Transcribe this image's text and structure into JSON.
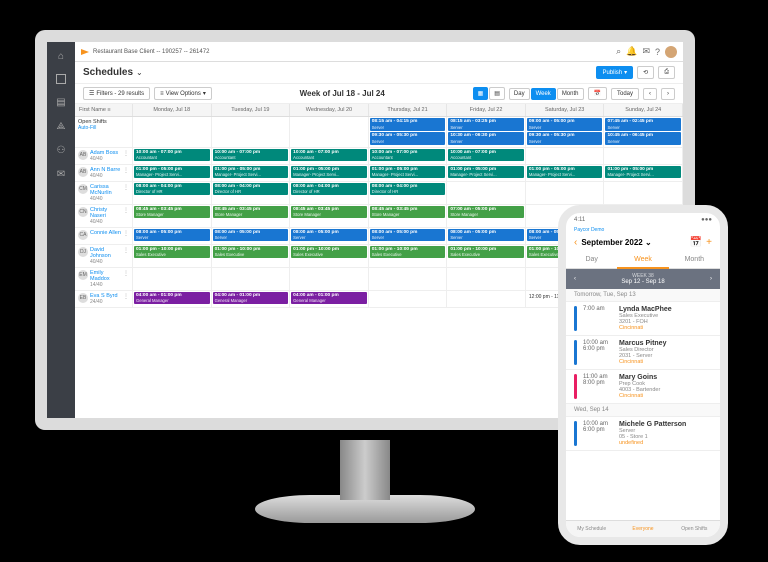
{
  "breadcrumb": "Restaurant Base Client -- 190257 -- 261472",
  "page_title": "Schedules",
  "publish": "Publish",
  "filters": "Filters - 29 results",
  "viewopts": "View Options",
  "week_label": "Week of Jul 18 - Jul 24",
  "views": {
    "day": "Day",
    "week": "Week",
    "month": "Month",
    "today": "Today"
  },
  "cols": [
    "First Name",
    "Monday, Jul 18",
    "Tuesday, Jul 19",
    "Wednesday, Jul 20",
    "Thursday, Jul 21",
    "Friday, Jul 22",
    "Saturday, Jul 23",
    "Sunday, Jul 24"
  ],
  "open": {
    "label": "Open Shifts",
    "auto": "Auto-Fill",
    "shifts": [
      {
        "t": "08:15 am - 04:15 pm",
        "r": "Server"
      },
      {
        "t": "08:15 am - 03:25 pm",
        "r": "Server"
      },
      {
        "t": "09:00 am - 05:00 pm",
        "r": "Server"
      },
      {
        "t": "07:45 am - 02:45 pm",
        "r": "Server"
      },
      {
        "t": "09:30 am - 05:30 pm",
        "r": "Server"
      },
      {
        "t": "10:30 am - 06:30 pm",
        "r": "Server"
      },
      {
        "t": "09:30 am - 05:30 pm",
        "r": "Server"
      },
      {
        "t": "10:45 am - 06:45 pm",
        "r": "Server"
      }
    ]
  },
  "rows": [
    {
      "i": "AB",
      "n": "Adam Boss",
      "h": "40/40",
      "c": "s-teal",
      "s": "10:00 am - 07:00 pm",
      "r": "Accountant",
      "days": 5
    },
    {
      "i": "AB",
      "n": "Ann N Barre",
      "h": "40/40",
      "c": "s-teal",
      "s": "01:00 pm - 05:00 pm",
      "r": "Manager- Project Servi...",
      "days": 7
    },
    {
      "i": "CM",
      "n": "Carissa McNurlin",
      "h": "40/40",
      "c": "s-teal",
      "s": "08:00 am - 04:00 pm",
      "r": "Director of HR",
      "days": 4
    },
    {
      "i": "CN",
      "n": "Christy Naseri",
      "h": "40/40",
      "c": "s-green",
      "s": "08:45 am - 03:45 pm",
      "r": "Store Manager",
      "days": 4,
      "extra": {
        "t": "07:00 am - 05:00 pm",
        "r": "Store Manager"
      }
    },
    {
      "i": "CA",
      "n": "Connie Allen",
      "h": "",
      "c": "s-blue",
      "s": "08:00 am - 05:00 pm",
      "r": "Server",
      "days": 6
    },
    {
      "i": "DJ",
      "n": "David Johnson",
      "h": "40/40",
      "c": "s-green",
      "s": "01:00 pm - 10:00 pm",
      "r": "Sales Executive",
      "days": 6
    },
    {
      "i": "EM",
      "n": "Emily Maddox",
      "h": "14/40",
      "c": "",
      "s": "",
      "r": "",
      "days": 0
    },
    {
      "i": "EB",
      "n": "Eva S Byrd",
      "h": "24/40",
      "c": "s-purple",
      "s": "04:00 am - 01:00 pm",
      "r": "General Manager",
      "days": 3,
      "tail": "12:00 pm - 11:59 pm"
    }
  ],
  "phone": {
    "time": "4:11",
    "carrier": "Paycor Demo",
    "month": "September 2022",
    "tabs": {
      "day": "Day",
      "week": "Week",
      "month": "Month"
    },
    "wk_label": "WEEK 38",
    "wk_range": "Sep 12 - Sep 18",
    "sec1": "Tomorrow, Tue, Sep 13",
    "items": [
      {
        "c": "#1976d2",
        "t1": "7:00 am",
        "t2": "",
        "n": "Lynda MacPhee",
        "d": "Sales Executive",
        "loc": "3201 - FOH",
        "city": "Cincinnati"
      },
      {
        "c": "#1976d2",
        "t1": "10:00 am",
        "t2": "6:00 pm",
        "n": "Marcus Pitney",
        "d": "Sales Director",
        "loc": "2031 - Server",
        "city": "Cincinnati"
      },
      {
        "c": "#e91e63",
        "t1": "11:00 am",
        "t2": "8:00 pm",
        "n": "Mary Goins",
        "d": "Prep Cook",
        "loc": "4003 - Bartender",
        "city": "Cincinnati"
      }
    ],
    "sec2": "Wed, Sep 14",
    "items2": [
      {
        "c": "#1976d2",
        "t1": "10:00 am",
        "t2": "6:00 pm",
        "n": "Michele G Patterson",
        "d": "Server",
        "loc": "05 - Store 1"
      }
    ],
    "nav": [
      "My Schedule",
      "Everyone",
      "Open Shifts"
    ]
  }
}
